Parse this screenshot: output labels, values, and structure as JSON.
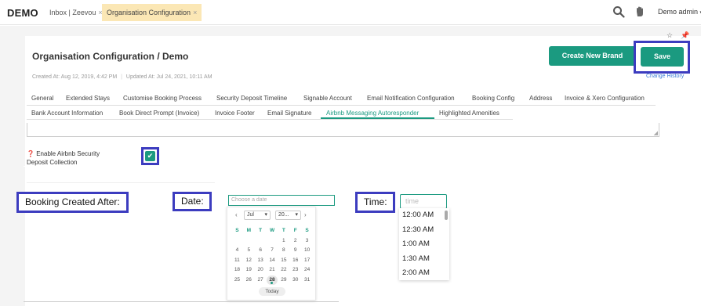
{
  "app": {
    "brand": "DEMO",
    "tabs": [
      {
        "label": "Inbox | Zeevou",
        "close": "×"
      },
      {
        "label": "Organisation Configuration",
        "close": "×"
      }
    ],
    "user": "Demo admin"
  },
  "page": {
    "title": "Organisation Configuration / Demo",
    "meta_created": "Created At: Aug 12, 2019, 4:42 PM",
    "meta_updated": "Updated At: Jul 24, 2021, 10:11 AM",
    "create_brand_label": "Create New Brand",
    "save_label": "Save",
    "change_history": "Change History"
  },
  "tabs_row1": [
    "General",
    "Extended Stays",
    "Customise Booking Process",
    "Security Deposit Timeline",
    "Signable Account",
    "Email Notification Configuration",
    "Booking Config",
    "Address",
    "Invoice & Xero Configuration"
  ],
  "tabs_row2": [
    "Bank Account Information",
    "Book Direct Prompt (Invoice)",
    "Invoice Footer",
    "Email Signature",
    "Airbnb Messaging Autoresponder",
    "Highlighted Amenities"
  ],
  "form": {
    "deposit_label": "Enable Airbnb Security Deposit Collection",
    "checkbox_mark": "✔"
  },
  "callouts": {
    "booking_created": "Booking Created After:",
    "date": "Date:",
    "time": "Time:"
  },
  "datepicker": {
    "placeholder": "Choose a date",
    "month": "Jul",
    "year": "20...",
    "prev": "‹",
    "next": "›",
    "weekdays": [
      "S",
      "M",
      "T",
      "W",
      "T",
      "F",
      "S"
    ],
    "weeks": [
      [
        "",
        "",
        "",
        "",
        "1",
        "2",
        "3"
      ],
      [
        "4",
        "5",
        "6",
        "7",
        "8",
        "9",
        "10"
      ],
      [
        "11",
        "12",
        "13",
        "14",
        "15",
        "16",
        "17"
      ],
      [
        "18",
        "19",
        "20",
        "21",
        "22",
        "23",
        "24"
      ],
      [
        "25",
        "26",
        "27",
        "28",
        "29",
        "30",
        "31"
      ]
    ],
    "today_day": "28",
    "today_label": "Today"
  },
  "timepicker": {
    "placeholder": "time",
    "options": [
      "12:00 AM",
      "12:30 AM",
      "1:00 AM",
      "1:30 AM",
      "2:00 AM"
    ]
  },
  "colors": {
    "accent": "#1b9a80",
    "highlight": "#3c3cbf",
    "active_tab": "#fbe7b5"
  }
}
